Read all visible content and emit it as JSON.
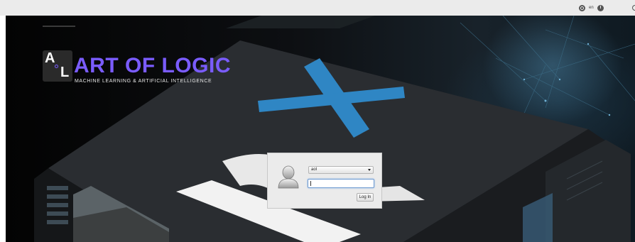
{
  "topbar": {
    "icons": [
      "network-icon",
      "power-icon"
    ],
    "keyboard_layout": "en"
  },
  "logo": {
    "mark_letters": [
      "A",
      "L"
    ],
    "title": "ART OF LOGIC",
    "subtitle": "MACHINE LEARNING & ARTIFICIAL INTELLIGENCE"
  },
  "login": {
    "user_select": "aol",
    "password": "",
    "login_button": "Log In"
  },
  "colors": {
    "brand": "#7a5cff",
    "accent_blue": "#2f86c4",
    "dialog_bg": "#ebebeb"
  }
}
